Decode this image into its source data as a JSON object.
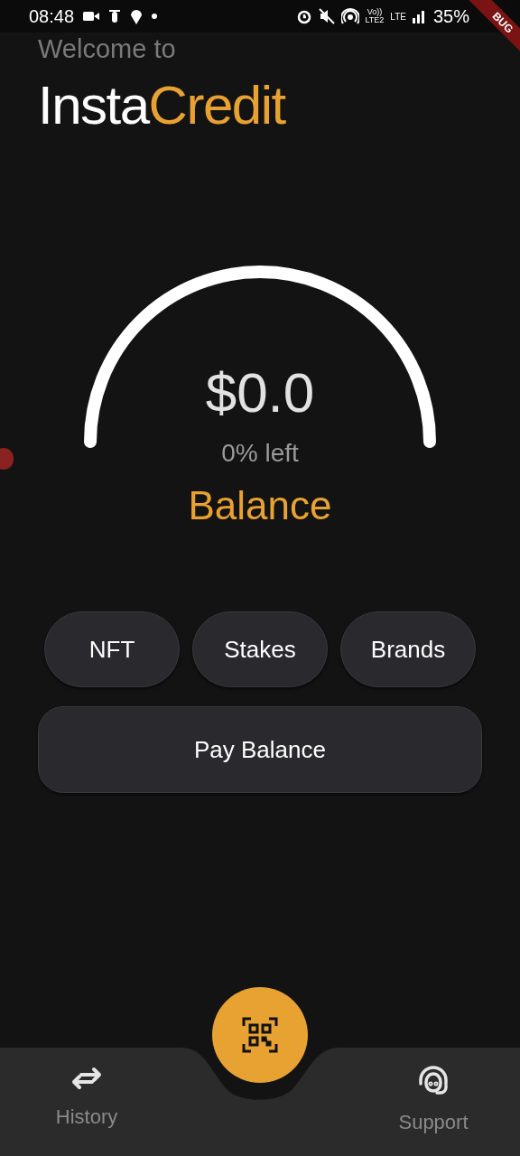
{
  "status_bar": {
    "time": "08:48",
    "volte_top": "Vo))",
    "volte_bottom": "LTE2",
    "network": "LTE",
    "battery": "35%"
  },
  "debug_banner": {
    "text": "BUG"
  },
  "header": {
    "welcome": "Welcome to",
    "brand_first": "Insta",
    "brand_second": "Credit"
  },
  "gauge": {
    "amount": "$0.0",
    "reading": "0% left",
    "label": "Balance"
  },
  "actions": [
    {
      "label": "NFT"
    },
    {
      "label": "Stakes"
    },
    {
      "label": "Brands"
    }
  ],
  "pay_button": {
    "label": "Pay Balance"
  },
  "bottom_nav": [
    {
      "kind": "history",
      "label": "History"
    },
    {
      "kind": "scan"
    },
    {
      "kind": "support",
      "label": "Support"
    }
  ]
}
